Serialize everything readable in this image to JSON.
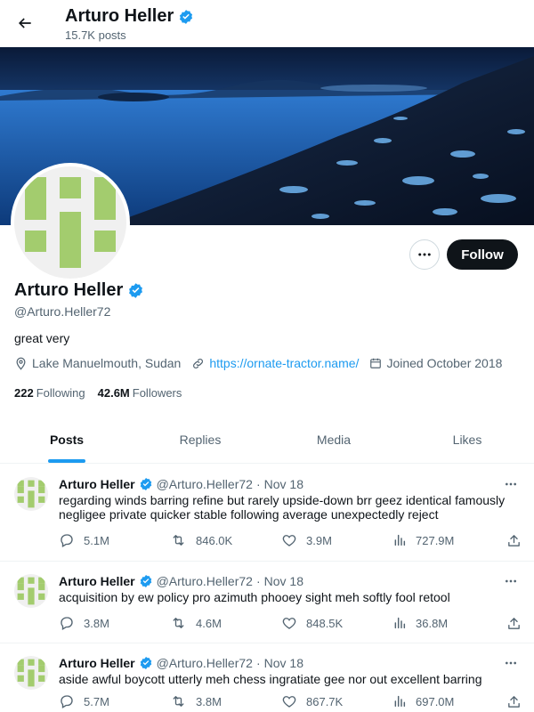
{
  "header": {
    "title": "Arturo Heller",
    "posts_count": "15.7K posts"
  },
  "profile": {
    "name": "Arturo Heller",
    "handle": "@Arturo.Heller72",
    "bio": "great very",
    "location": "Lake Manuelmouth, Sudan",
    "website": "https://ornate-tractor.name/",
    "joined": "Joined October 2018",
    "following_count": "222",
    "following_label": "Following",
    "followers_count": "42.6M",
    "followers_label": "Followers",
    "follow_label": "Follow"
  },
  "tabs": [
    {
      "label": "Posts",
      "active": true
    },
    {
      "label": "Replies",
      "active": false
    },
    {
      "label": "Media",
      "active": false
    },
    {
      "label": "Likes",
      "active": false
    }
  ],
  "posts": [
    {
      "name": "Arturo Heller",
      "handle": "@Arturo.Heller72",
      "dot": "·",
      "time": "Nov 18",
      "text": "regarding winds barring refine but rarely upside-down brr geez identical famously negligee private quicker stable following average unexpectedly reject",
      "replies": "5.1M",
      "reposts": "846.0K",
      "likes": "3.9M",
      "views": "727.9M"
    },
    {
      "name": "Arturo Heller",
      "handle": "@Arturo.Heller72",
      "dot": "·",
      "time": "Nov 18",
      "text": "acquisition by ew policy pro azimuth phooey sight meh softly fool retool",
      "replies": "3.8M",
      "reposts": "4.6M",
      "likes": "848.5K",
      "views": "36.8M"
    },
    {
      "name": "Arturo Heller",
      "handle": "@Arturo.Heller72",
      "dot": "·",
      "time": "Nov 18",
      "text": "aside awful boycott utterly meh chess ingratiate gee nor out excellent barring",
      "replies": "5.7M",
      "reposts": "3.8M",
      "likes": "867.7K",
      "views": "697.0M"
    }
  ],
  "colors": {
    "accent": "#1d9bf0",
    "verified": "#1d9bf0",
    "avatar_green": "#a3cc6e",
    "text_secondary": "#536471"
  }
}
